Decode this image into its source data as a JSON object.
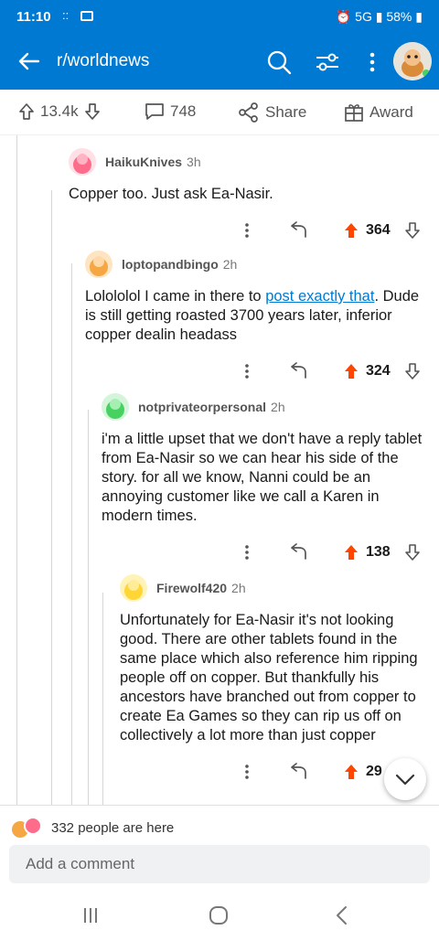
{
  "status": {
    "time": "11:10",
    "notif": "::",
    "network": "5G",
    "battery": "58%"
  },
  "header": {
    "title": "r/worldnews"
  },
  "action_bar": {
    "upvotes": "13.4k",
    "comments": "748",
    "share_label": "Share",
    "award_label": "Award"
  },
  "comments": [
    {
      "author": "HaikuKnives",
      "time": "3h",
      "body": "Copper too. Just ask Ea-Nasir.",
      "score": "364",
      "avatar_color": "#ff6b8a"
    },
    {
      "author": "loptopandbingo",
      "time": "2h",
      "body_before": "Lolololol I came in there to ",
      "link_text": "post exactly that",
      "body_after": ". Dude is still getting roasted 3700 years later, inferior copper dealin headass",
      "score": "324",
      "avatar_color": "#f4a742"
    },
    {
      "author": "notprivateorpersonal",
      "time": "2h",
      "body": "i'm a little upset that we don't have a reply tablet from Ea-Nasir so we can hear his side of the story. for all we know, Nanni could be an annoying customer like we call a Karen in modern times.",
      "score": "138",
      "avatar_color": "#46d160"
    },
    {
      "author": "Firewolf420",
      "time": "2h",
      "body": "Unfortunately for Ea-Nasir it's not looking good. There are other tablets found in the same place which also reference him ripping people off on copper. But thankfully his ancestors have branched out from copper to create Ea Games so they can rip us off on collectively a lot more than just copper",
      "score": "29",
      "avatar_color": "#ffd635"
    }
  ],
  "presence": {
    "label": "332 people are here"
  },
  "compose": {
    "placeholder": "Add a comment"
  },
  "colors": {
    "brand": "#0079d3",
    "upvote": "#ff4500"
  }
}
